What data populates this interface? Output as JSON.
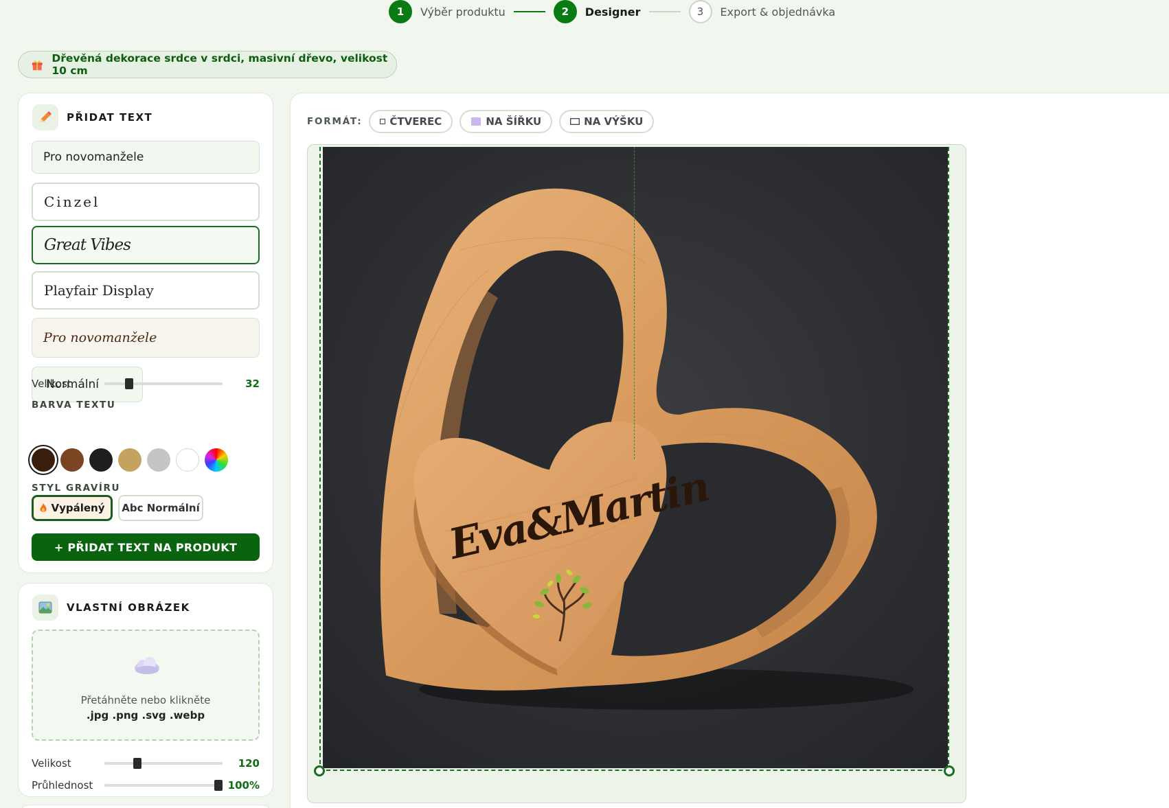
{
  "stepper": {
    "steps": [
      {
        "number": "1",
        "label": "Výběr produktu"
      },
      {
        "number": "2",
        "label": "Designer"
      },
      {
        "number": "3",
        "label": "Export & objednávka"
      }
    ]
  },
  "product": {
    "title": "Dřevěná dekorace srdce v srdci, masivní dřevo, velikost 10 cm"
  },
  "add_text": {
    "heading": "PŘIDAT TEXT",
    "input_value": "Pro novomanžele",
    "fonts": [
      "Cinzel",
      "Great Vibes",
      "Playfair Display"
    ],
    "selected_font": "Great Vibes",
    "preview": "Pro novomanžele",
    "weight_select": "Normální",
    "size_label": "Velikost",
    "size_value": "32",
    "color_label": "BARVA TEXTU",
    "colors": [
      "#3a1e0c",
      "#7b4423",
      "#1e1e1e",
      "#c4a25f",
      "#c5c5c5",
      "#ffffff"
    ],
    "engraving_label": "STYL GRAVÍRU",
    "engraving_burned": "Vypálený",
    "engraving_normal": "Abc Normální",
    "add_button": "+ PŘIDAT TEXT NA PRODUKT"
  },
  "custom_image": {
    "heading": "VLASTNÍ OBRÁZEK",
    "drop_text": "Přetáhněte nebo klikněte",
    "formats": ".jpg .png .svg .webp",
    "size_label": "Velikost",
    "size_value": "120",
    "opacity_label": "Průhlednost",
    "opacity_value": "100%"
  },
  "canvas": {
    "format_label": "FORMÁT:",
    "format_options": [
      "ČTVEREC",
      "NA ŠÍŘKU",
      "NA VÝŠKU"
    ],
    "engraved_text": "Eva&Martin"
  }
}
